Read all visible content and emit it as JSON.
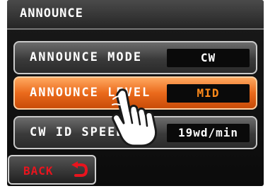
{
  "header": {
    "title": "ANNOUNCE"
  },
  "menu": {
    "items": [
      {
        "label": "ANNOUNCE MODE",
        "value": "CW",
        "selected": false
      },
      {
        "label": "ANNOUNCE LEVEL",
        "value": "MID",
        "selected": true
      },
      {
        "label": "CW ID SPEED",
        "value": "19wd/min",
        "selected": false
      }
    ]
  },
  "footer": {
    "back_label": "BACK"
  },
  "icons": {
    "back": "return-arrow-icon",
    "pointer": "pointing-hand-icon"
  },
  "colors": {
    "selected_row": "#ea6a1c",
    "selected_value": "#ff8a1a",
    "back_text": "#e8141e",
    "back_arrow": "#e8141e"
  }
}
